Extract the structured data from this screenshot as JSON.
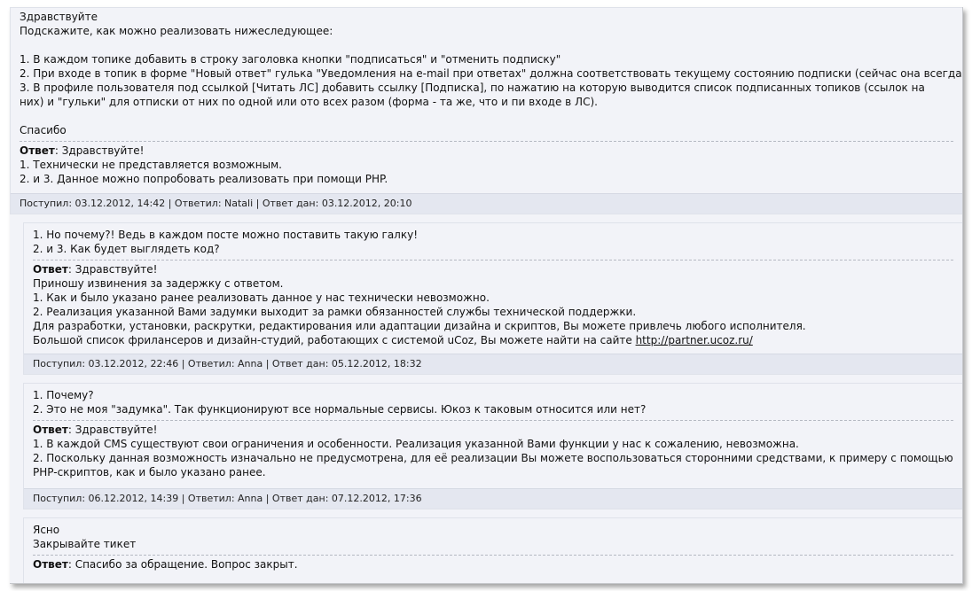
{
  "posts": [
    {
      "question": [
        "Здравствуйте",
        "Подскажите, как можно реализовать нижеследующее:",
        "",
        "1. В каждом топике добавить в строку заголовка кнопки \"подписаться\" и \"отменить подписку\"",
        "2. При входе в топик в форме \"Новый ответ\" гулька \"Уведомления на e-mail при ответах\" должна соответствовать текущему состоянию подписки (сейчас она всегда False)",
        "3. В профиле пользователя под ссылкой [Читать ЛС] добавить ссылку [Подписка], по нажатию на которую выводится список подписанных топиков (ссылок на них) и \"гульки\" для отписки от них по одной или ото всех разом (форма - та же, что и пи входе в ЛС).",
        "",
        "Спасибо"
      ],
      "answer_label": "Ответ",
      "answer_first": ": Здравствуйте!",
      "answer": [
        "1. Технически не представляется возможным.",
        "2. и 3. Данное можно попробовать реализовать при помощи PHP."
      ],
      "meta": "Поступил: 03.12.2012, 14:42 | Ответил: Natali | Ответ дан: 03.12.2012, 20:10"
    },
    {
      "question": [
        "1. Но почему?! Ведь в каждом посте можно поставить такую галку!",
        "2. и 3. Как будет выглядеть код?"
      ],
      "answer_label": "Ответ",
      "answer_first": ": Здравствуйте!",
      "answer": [
        "Приношу извинения за задержку с ответом.",
        "1. Как и было указано ранее реализовать данное у нас технически невозможно.",
        "2. Реализация указанной Вами задумки выходит за рамки обязанностей службы технической поддержки.",
        "Для разработки, установки, раскрутки, редактирования или адаптации дизайна и скриптов, Вы можете привлечь любого исполнителя."
      ],
      "answer_link_prefix": "Большой список фрилансеров и дизайн-студий, работающих с системой uCoz, Вы можете найти на сайте ",
      "answer_link": "http://partner.ucoz.ru/",
      "meta": "Поступил: 03.12.2012, 22:46 | Ответил: Anna | Ответ дан: 05.12.2012, 18:32"
    },
    {
      "question": [
        "1. Почему?",
        "2. Это не моя \"задумка\". Так функционируют все нормальные сервисы. Юкоз к таковым относится или нет?"
      ],
      "answer_label": "Ответ",
      "answer_first": ": Здравствуйте!",
      "answer": [
        "1. В каждой CMS существуют свои ограничения и особенности. Реализация указанной Вами функции у нас к сожалению, невозможна.",
        "2. Поскольку данная возможность изначально не предусмотрена, для её реализации Вы можете воспользоваться сторонними средствами, к примеру с помощью PHP-скриптов, как и было указано ранее."
      ],
      "meta": "Поступил: 06.12.2012, 14:39 | Ответил: Anna | Ответ дан: 07.12.2012, 17:36"
    },
    {
      "question": [
        "Ясно",
        "Закрывайте тикет"
      ],
      "answer_label": "Ответ",
      "answer_first": ": Спасибо за обращение. Вопрос закрыт."
    }
  ]
}
